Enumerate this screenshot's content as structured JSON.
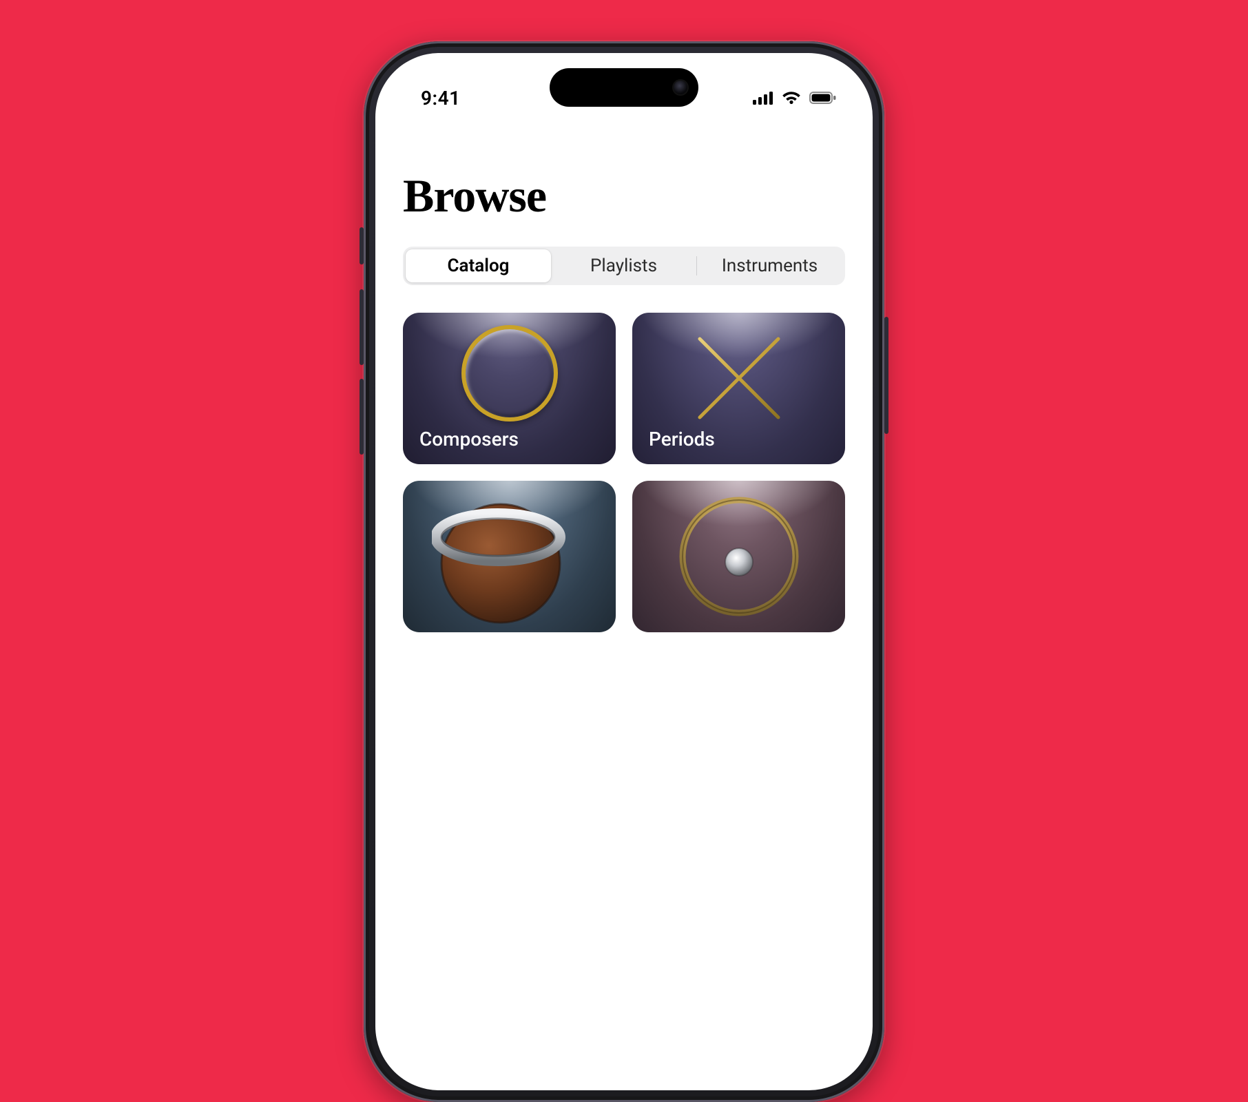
{
  "status": {
    "time": "9:41"
  },
  "page": {
    "title": "Browse"
  },
  "segments": {
    "items": [
      {
        "label": "Catalog",
        "active": true
      },
      {
        "label": "Playlists",
        "active": false
      },
      {
        "label": "Instruments",
        "active": false
      }
    ]
  },
  "cards": {
    "composers": {
      "label": "Composers"
    },
    "periods": {
      "label": "Periods"
    }
  },
  "icons": {
    "cellular": "cellular-icon",
    "wifi": "wifi-icon",
    "battery": "battery-icon",
    "camera": "camera-icon"
  }
}
